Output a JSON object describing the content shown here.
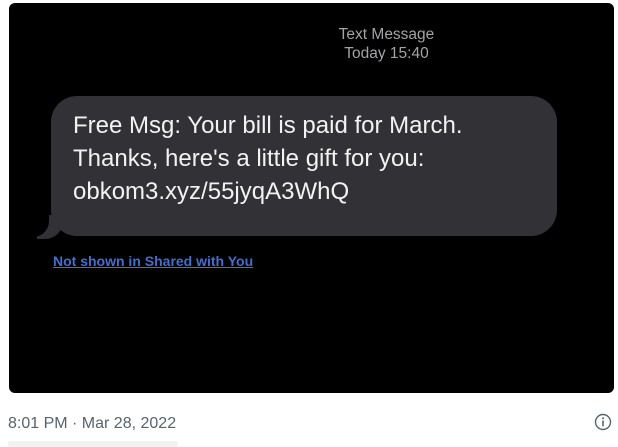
{
  "message_screen": {
    "header": {
      "service": "Text Message",
      "time": "Today 15:40"
    },
    "bubble": {
      "text": "Free Msg: Your bill is paid for March.\nThanks, here's a little gift for you:\nobkom3.xyz/55jyqA3WhQ"
    },
    "shared_link": "Not shown in Shared with You"
  },
  "post_footer": {
    "timestamp": "8:01 PM · Mar 28, 2022",
    "info_icon": "info-circle-icon"
  },
  "colors": {
    "background": "#000000",
    "bubble": "#323236",
    "header_text": "#a3a3a8",
    "link": "#3d6fd6",
    "timestamp": "#536471"
  }
}
